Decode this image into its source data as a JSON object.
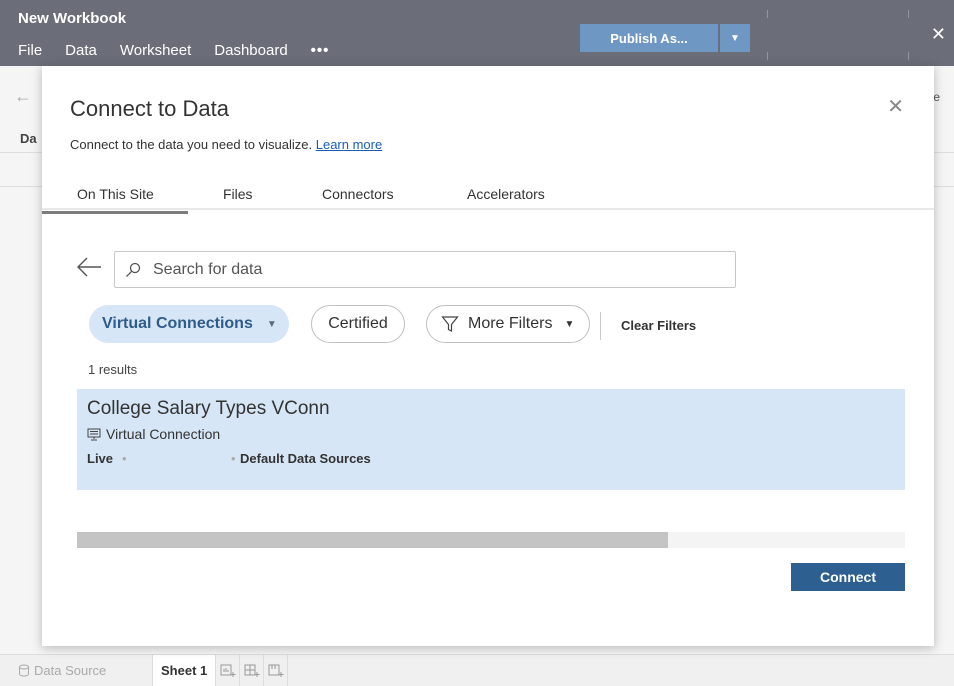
{
  "app": {
    "title": "New Workbook",
    "menu": [
      "File",
      "Data",
      "Worksheet",
      "Dashboard"
    ],
    "more_label": "•••",
    "publish_label": "Publish As...",
    "close_glyph": "✕"
  },
  "background": {
    "partial_label": "Da",
    "partial_right": "e"
  },
  "dialog": {
    "title": "Connect to Data",
    "subtitle": "Connect to the data you need to visualize.",
    "learn_more": "Learn more",
    "close_glyph": "✕",
    "tabs": [
      "On This Site",
      "Files",
      "Connectors",
      "Accelerators"
    ],
    "active_tab": "On This Site",
    "search": {
      "placeholder": "Search for data",
      "value": ""
    },
    "filters": {
      "virtual_connections": "Virtual Connections",
      "certified": "Certified",
      "more_filters": "More Filters",
      "clear_filters": "Clear Filters"
    },
    "results_count": "1 results",
    "results": [
      {
        "name": "College Salary Types VConn",
        "type": "Virtual Connection",
        "mode": "Live",
        "data_sources": "Default Data Sources"
      }
    ],
    "scroll_fraction": 0.714,
    "connect_label": "Connect"
  },
  "tabbar": {
    "data_source": "Data Source",
    "sheet": "Sheet 1"
  },
  "colors": {
    "appbar": "#6b6d78",
    "accent": "#2e5f91",
    "chip_selected": "#d6e6f6",
    "publish": "#6f97c3"
  }
}
